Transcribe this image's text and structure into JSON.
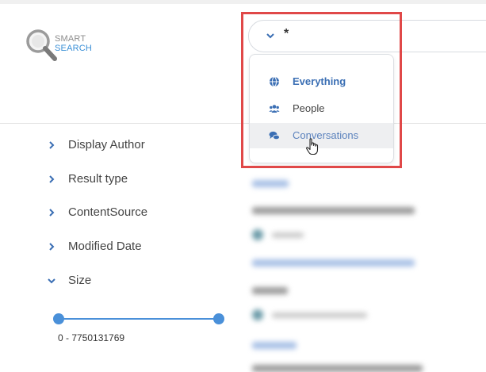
{
  "logo": {
    "line1": "SMART",
    "line2": "SEARCH"
  },
  "search": {
    "value": "*",
    "scope_icon": "chevron-down-icon"
  },
  "dropdown": {
    "items": [
      {
        "label": "Everything",
        "icon": "globe-icon"
      },
      {
        "label": "People",
        "icon": "users-icon"
      },
      {
        "label": "Conversations",
        "icon": "comments-icon"
      }
    ]
  },
  "filters": [
    {
      "label": "Display Author",
      "state": "collapsed"
    },
    {
      "label": "Result type",
      "state": "collapsed"
    },
    {
      "label": "ContentSource",
      "state": "collapsed"
    },
    {
      "label": "Modified Date",
      "state": "collapsed"
    },
    {
      "label": "Size",
      "state": "expanded"
    }
  ],
  "size_filter": {
    "range_label": "0 - 7750131769",
    "min": 0,
    "max": 7750131769
  },
  "colors": {
    "accent": "#4a90d9",
    "highlight": "#e04848",
    "link": "#3b6fb4"
  }
}
